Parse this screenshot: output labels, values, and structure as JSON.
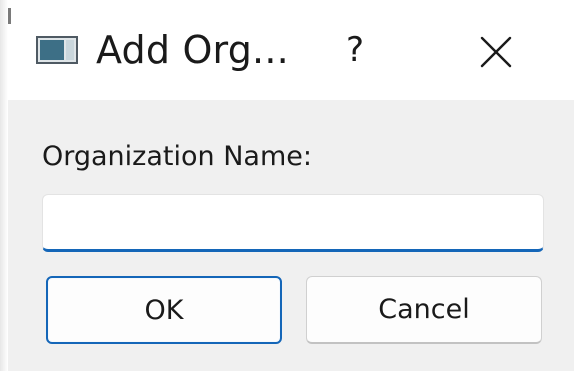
{
  "window": {
    "title": "Add Org...",
    "help_label": "?",
    "icon": "app-window-icon",
    "close_icon": "close-icon"
  },
  "form": {
    "label": "Organization Name:",
    "input_value": "",
    "input_placeholder": ""
  },
  "buttons": {
    "ok_label": "OK",
    "cancel_label": "Cancel"
  },
  "colors": {
    "accent": "#1466b8",
    "client_background": "#f0f0f0",
    "titlebar_background": "#ffffff"
  }
}
